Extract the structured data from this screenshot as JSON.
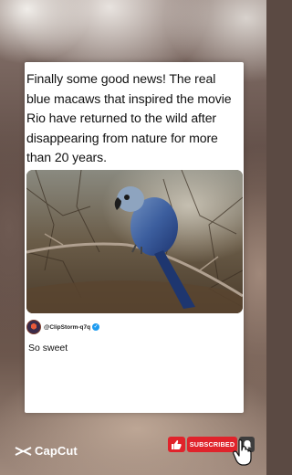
{
  "post": {
    "caption": "Finally some good news! The real blue macaws that inspired the movie Rio have returned to the wild after disappearing from nature for more than 20 years.",
    "image_subject": "blue-macaw-on-branch",
    "author_handle": "@ClipStorm-q7q",
    "reply_text": "So sweet"
  },
  "branding": {
    "app_name": "CapCut"
  },
  "subscribe": {
    "label": "SUBSCRIBED"
  },
  "icons": {
    "logo": "capcut-logo-icon",
    "like": "thumbs-up-icon",
    "bell": "bell-icon",
    "verified": "verified-badge-icon",
    "cursor": "hand-cursor-icon"
  },
  "colors": {
    "subscribe_red": "#e0232b",
    "bell_bg": "#3d3d3d",
    "verified_blue": "#1d9bf0"
  }
}
